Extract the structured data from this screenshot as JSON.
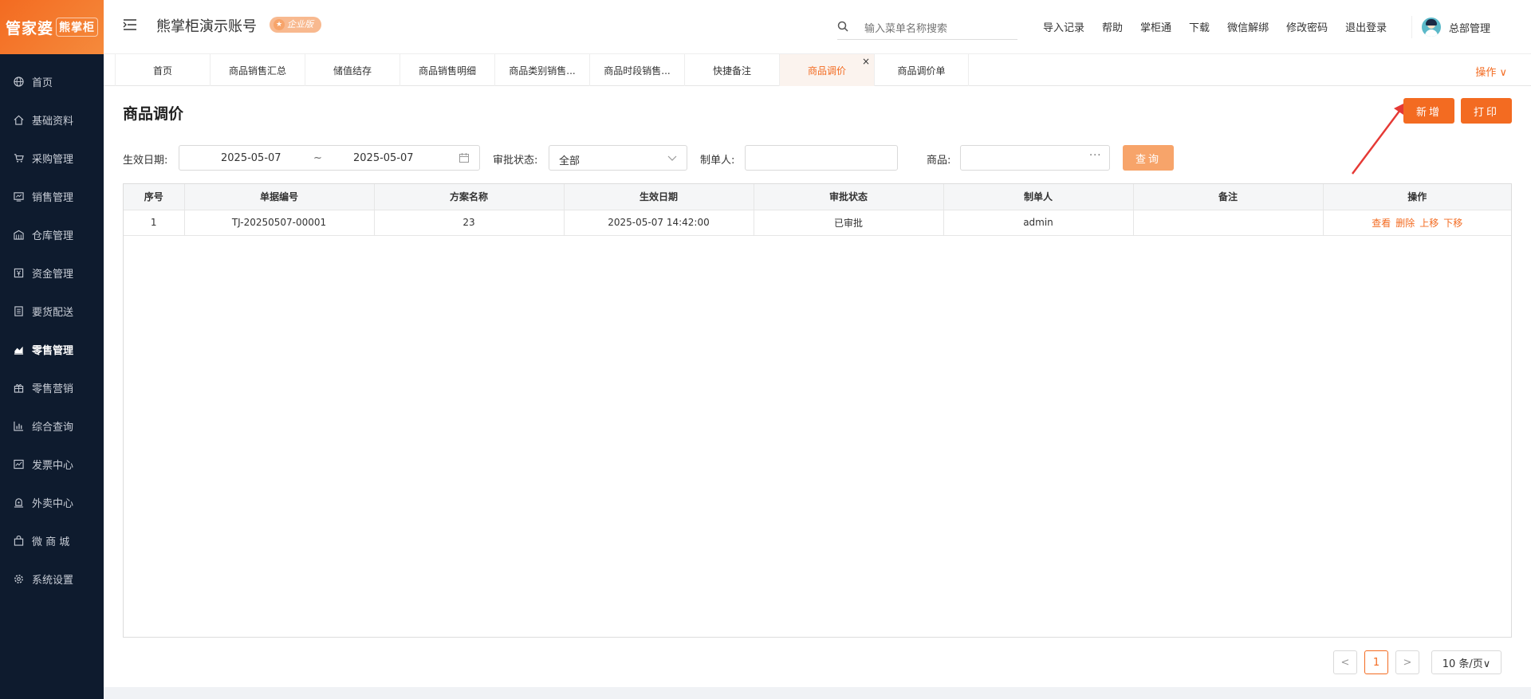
{
  "logo": {
    "text_a": "管家婆",
    "text_b": "熊掌柜"
  },
  "sidebar": {
    "items": [
      {
        "label": "首页",
        "icon": "globe-icon"
      },
      {
        "label": "基础资料",
        "icon": "home-icon"
      },
      {
        "label": "采购管理",
        "icon": "cart-icon"
      },
      {
        "label": "销售管理",
        "icon": "monitor-icon"
      },
      {
        "label": "仓库管理",
        "icon": "warehouse-icon"
      },
      {
        "label": "资金管理",
        "icon": "money-icon"
      },
      {
        "label": "要货配送",
        "icon": "document-icon"
      },
      {
        "label": "零售管理",
        "icon": "chart-icon",
        "active": true
      },
      {
        "label": "零售营销",
        "icon": "gift-icon"
      },
      {
        "label": "综合查询",
        "icon": "bar-chart-icon"
      },
      {
        "label": "发票中心",
        "icon": "invoice-icon"
      },
      {
        "label": "外卖中心",
        "icon": "delivery-icon"
      },
      {
        "label": "微 商 城",
        "icon": "bag-icon"
      },
      {
        "label": "系统设置",
        "icon": "gear-icon"
      }
    ]
  },
  "header": {
    "account_title": "熊掌柜演示账号",
    "edition_badge": "企业版",
    "search_placeholder": "输入菜单名称搜索",
    "links": [
      "导入记录",
      "帮助",
      "掌柜通",
      "下载",
      "微信解绑",
      "修改密码",
      "退出登录"
    ],
    "user_name": "总部管理"
  },
  "tabs": {
    "items": [
      "首页",
      "商品销售汇总",
      "储值结存",
      "商品销售明细",
      "商品类别销售...",
      "商品时段销售...",
      "快捷备注",
      "商品调价",
      "商品调价单"
    ],
    "active_index": 7,
    "close_glyph": "×",
    "ops_label": "操作 ∨"
  },
  "page": {
    "title": "商品调价",
    "new_button": "新增",
    "print_button": "打印"
  },
  "filters": {
    "date_label": "生效日期:",
    "date_start": "2025-05-07",
    "date_sep": "~",
    "date_end": "2025-05-07",
    "status_label": "审批状态:",
    "status_value": "全部",
    "maker_label": "制单人:",
    "goods_label": "商品:",
    "goods_more": "···",
    "query_button": "查询"
  },
  "table": {
    "columns": [
      "序号",
      "单据编号",
      "方案名称",
      "生效日期",
      "审批状态",
      "制单人",
      "备注",
      "操作"
    ],
    "rows": [
      [
        "1",
        "TJ-20250507-00001",
        "23",
        "2025-05-07 14:42:00",
        "已审批",
        "admin",
        ""
      ]
    ],
    "actions": [
      "查看",
      "删除",
      "上移",
      "下移"
    ]
  },
  "pagination": {
    "prev": "<",
    "current_page": "1",
    "next": ">",
    "page_size": "10 条/页∨"
  },
  "colors": {
    "accent": "#f36b21",
    "sidebar": "#0e1b2e"
  }
}
